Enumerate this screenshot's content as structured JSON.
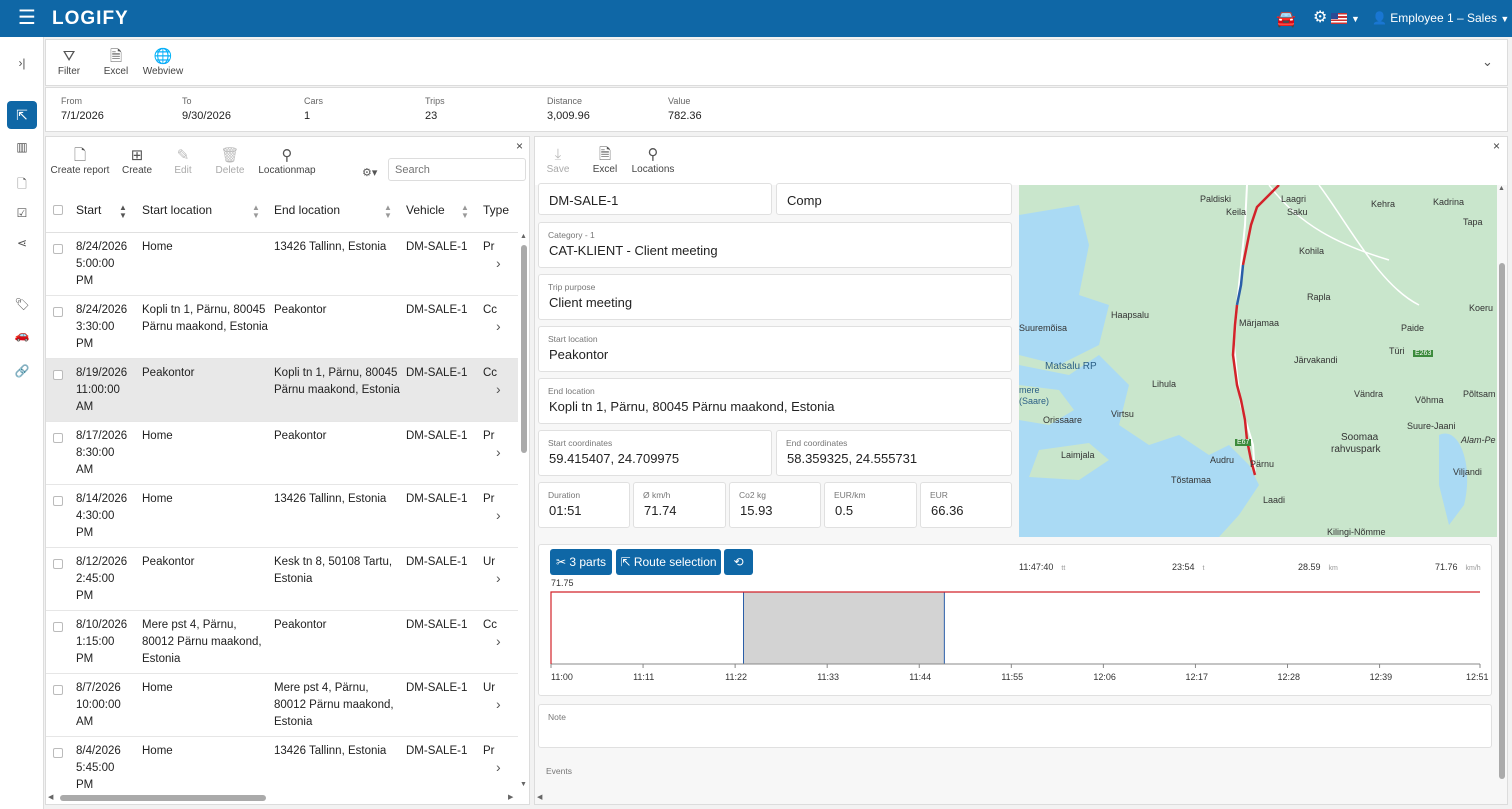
{
  "header": {
    "logo": "LOGIFY",
    "user": "Employee 1 – Sales"
  },
  "toolbar_top": {
    "filter": "Filter",
    "excel": "Excel",
    "webview": "Webview"
  },
  "summary": [
    {
      "label": "From",
      "value": "7/1/2026"
    },
    {
      "label": "To",
      "value": "9/30/2026"
    },
    {
      "label": "Cars",
      "value": "1"
    },
    {
      "label": "Trips",
      "value": "23"
    },
    {
      "label": "Distance",
      "value": "3,009.96"
    },
    {
      "label": "Value",
      "value": "782.36"
    }
  ],
  "list_toolbar": {
    "create_report": "Create report",
    "create": "Create",
    "edit": "Edit",
    "delete": "Delete",
    "locationmap": "Locationmap",
    "search_placeholder": "Search"
  },
  "table": {
    "headers": [
      "Start",
      "Start location",
      "End location",
      "Vehicle",
      "Type"
    ],
    "rows": [
      {
        "start": [
          "8/24/2026",
          "5:00:00",
          "PM"
        ],
        "start_location": [
          "Home"
        ],
        "end_location": [
          "13426 Tallinn, Estonia"
        ],
        "vehicle": "DM-SALE-1",
        "type": "Pr"
      },
      {
        "start": [
          "8/24/2026",
          "3:30:00",
          "PM"
        ],
        "start_location": [
          "Kopli tn 1, Pärnu, 80045",
          "Pärnu maakond, Estonia"
        ],
        "end_location": [
          "Peakontor"
        ],
        "vehicle": "DM-SALE-1",
        "type": "Cc"
      },
      {
        "start": [
          "8/19/2026",
          "11:00:00",
          "AM"
        ],
        "start_location": [
          "Peakontor"
        ],
        "end_location": [
          "Kopli tn 1, Pärnu, 80045",
          "Pärnu maakond, Estonia"
        ],
        "vehicle": "DM-SALE-1",
        "type": "Cc"
      },
      {
        "start": [
          "8/17/2026",
          "8:30:00",
          "AM"
        ],
        "start_location": [
          "Home"
        ],
        "end_location": [
          "Peakontor"
        ],
        "vehicle": "DM-SALE-1",
        "type": "Pr"
      },
      {
        "start": [
          "8/14/2026",
          "4:30:00",
          "PM"
        ],
        "start_location": [
          "Home"
        ],
        "end_location": [
          "13426 Tallinn, Estonia"
        ],
        "vehicle": "DM-SALE-1",
        "type": "Pr"
      },
      {
        "start": [
          "8/12/2026",
          "2:45:00",
          "PM"
        ],
        "start_location": [
          "Peakontor"
        ],
        "end_location": [
          "Kesk tn 8, 50108 Tartu,",
          "Estonia"
        ],
        "vehicle": "DM-SALE-1",
        "type": "Ur"
      },
      {
        "start": [
          "8/10/2026",
          "1:15:00",
          "PM"
        ],
        "start_location": [
          "Mere pst 4, Pärnu,",
          "80012 Pärnu maakond,",
          "Estonia"
        ],
        "end_location": [
          "Peakontor"
        ],
        "vehicle": "DM-SALE-1",
        "type": "Cc"
      },
      {
        "start": [
          "8/7/2026",
          "10:00:00",
          "AM"
        ],
        "start_location": [
          "Home"
        ],
        "end_location": [
          "Mere pst 4, Pärnu,",
          "80012 Pärnu maakond,",
          "Estonia"
        ],
        "vehicle": "DM-SALE-1",
        "type": "Ur"
      },
      {
        "start": [
          "8/4/2026",
          "5:45:00",
          "PM"
        ],
        "start_location": [
          "Home"
        ],
        "end_location": [
          "13426 Tallinn, Estonia"
        ],
        "vehicle": "DM-SALE-1",
        "type": "Pr"
      }
    ]
  },
  "detail_toolbar": {
    "save": "Save",
    "excel": "Excel",
    "locations": "Locations"
  },
  "form": {
    "car_value": "DM-SALE-1",
    "type_value": "Comp",
    "category_label": "Category - 1",
    "category_value": "CAT-KLIENT - Client meeting",
    "purpose_label": "Trip purpose",
    "purpose_value": "Client meeting",
    "start_loc_label": "Start location",
    "start_loc_value": "Peakontor",
    "end_loc_label": "End location",
    "end_loc_value": "Kopli tn 1, Pärnu, 80045 Pärnu maakond, Estonia",
    "start_coord_label": "Start coordinates",
    "start_coord_value": "59.415407, 24.709975",
    "end_coord_label": "End coordinates",
    "end_coord_value": "58.359325, 24.555731",
    "duration_label": "Duration",
    "duration_value": "01:51",
    "speed_label": "Ø km/h",
    "speed_value": "71.74",
    "co2_label": "Co2 kg",
    "co2_value": "15.93",
    "eurkm_label": "EUR/km",
    "eurkm_value": "0.5",
    "eur_label": "EUR",
    "eur_value": "66.36",
    "note_label": "Note",
    "events_label": "Events"
  },
  "map_labels": [
    "Paldiski",
    "Keila",
    "Laagri",
    "Saku",
    "Kehra",
    "Kadrina",
    "Tapa",
    "Kohila",
    "Rapla",
    "Haapsalu",
    "Suuremõisa",
    "Märjamaa",
    "Paide",
    "Koeru",
    "Türi",
    "Järvakandi",
    "Matsalu RP",
    "Lihula",
    "Virtsu",
    "Orissaare",
    "Vändra",
    "Võhma",
    "Põltsam",
    "Suure-Jaani",
    "Soomaa",
    "rahvuspark",
    "Alam-Pe",
    "Laimjala",
    "Audru",
    "Pärnu",
    "Tõstamaa",
    "Laadi",
    "Viljandi",
    "Kilingi-Nõmme",
    "mere",
    "(Saare)",
    "E263",
    "E67"
  ],
  "chart": {
    "buttons": {
      "parts": "3 parts",
      "route": "Route selection"
    },
    "stats": [
      {
        "value": "11:47:40",
        "unit": "tt"
      },
      {
        "value": "23:54",
        "unit": "t"
      },
      {
        "value": "28.59",
        "unit": "km"
      },
      {
        "value": "71.76",
        "unit": "km/h"
      }
    ],
    "y_label": "71.75"
  },
  "chart_data": {
    "type": "line",
    "x": [
      "11:00",
      "11:11",
      "11:22",
      "11:33",
      "11:44",
      "11:55",
      "12:06",
      "12:17",
      "12:28",
      "12:39",
      "12:51"
    ],
    "series": [
      {
        "values": [
          71.75,
          71.75,
          71.75,
          71.75,
          71.75,
          71.75,
          71.75,
          71.75,
          71.75,
          71.75,
          71.75
        ]
      }
    ],
    "selection": [
      "11:23",
      "11:47"
    ]
  },
  "colors": {
    "brand": "#0f67a6",
    "route_red": "#d2232a",
    "route_blue": "#2a5ea8"
  }
}
